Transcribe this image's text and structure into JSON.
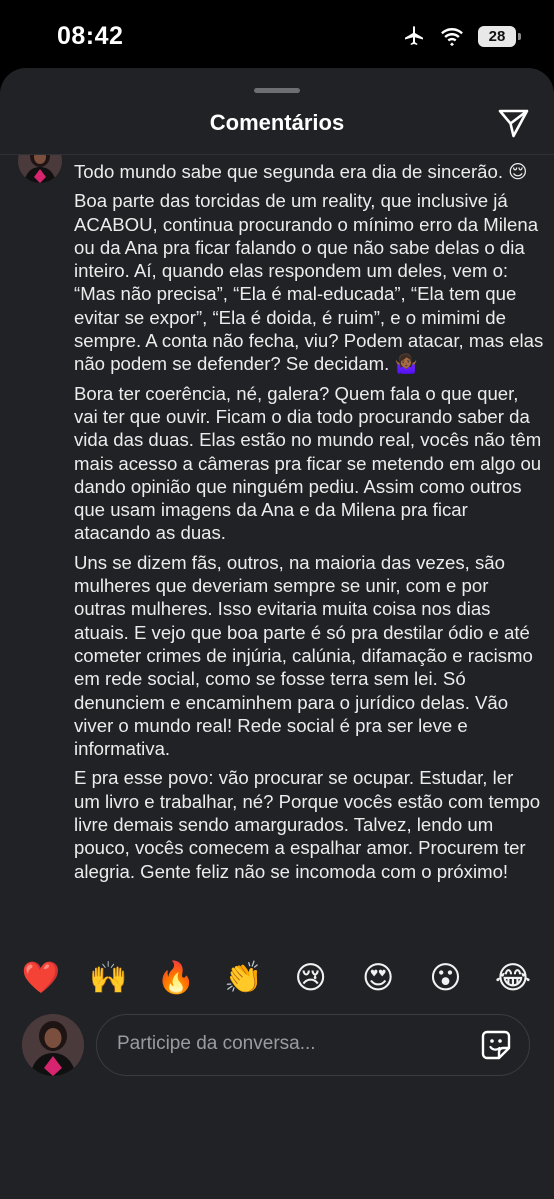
{
  "status_bar": {
    "time": "08:42",
    "battery": "28"
  },
  "sheet": {
    "title": "Comentários"
  },
  "comment": {
    "username": "",
    "paragraphs": [
      "Todo mundo sabe que segunda era dia de sincerão. 😌",
      "Boa parte das torcidas de um reality, que inclusive já ACABOU, continua procurando o mínimo erro da Milena ou da Ana pra ficar falando o que não sabe delas o dia inteiro. Aí, quando elas respondem um deles, vem o: “Mas não precisa”, “Ela é mal-educada”, “Ela tem que evitar se expor”, “Ela é doida, é ruim”, e o mimimi de sempre. A conta não fecha, viu? Podem atacar, mas elas não podem se defender? Se decidam. 🤷🏾‍♀️",
      "Bora ter coerência, né, galera? Quem fala o que quer, vai ter que ouvir. Ficam o dia todo procurando saber da vida das duas. Elas estão no mundo real, vocês não têm mais acesso a câmeras pra ficar se metendo em algo ou dando opinião que ninguém pediu. Assim como outros que usam imagens da Ana e da Milena pra ficar atacando as duas.",
      "Uns se dizem fãs, outros, na maioria das vezes, são mulheres que deveriam sempre se unir, com e por outras mulheres. Isso evitaria muita coisa nos dias atuais. E vejo que boa parte é só pra destilar ódio e até cometer crimes de injúria, calúnia, difamação e racismo em rede social, como se fosse terra sem lei. Só denunciem e encaminhem para o jurídico delas. Vão viver o mundo real! Rede social é pra ser leve e informativa.",
      "E pra esse povo: vão procurar se ocupar. Estudar, ler um livro e trabalhar, né? Porque vocês estão com tempo livre demais sendo amargurados. Talvez, lendo um pouco, vocês comecem a espalhar amor. Procurem ter alegria. Gente feliz não se incomoda com o próximo!"
    ]
  },
  "reactions": [
    "❤️",
    "🙌",
    "🔥",
    "👏",
    "😢",
    "😍",
    "😮",
    "😂"
  ],
  "composer": {
    "placeholder": "Participe da conversa..."
  }
}
